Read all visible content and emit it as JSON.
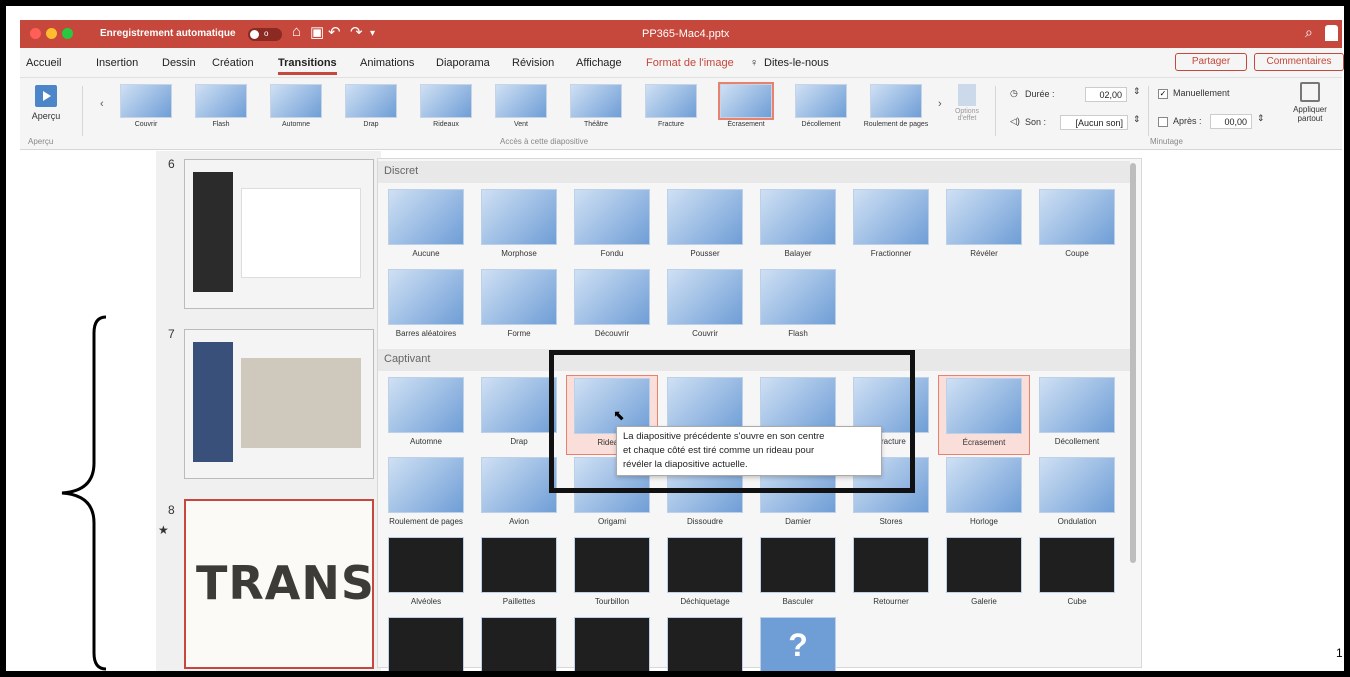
{
  "window": {
    "autosave": "Enregistrement automatique",
    "toggle_label": "o",
    "document_title": "PP365-Mac4.pptx"
  },
  "colors": {
    "accent": "#c6473b",
    "tile": "#6f9ed6",
    "tile_light": "#cfe0f4",
    "selected_tile": "#f9ded9",
    "dark_tile": "#1f1f1f"
  },
  "tabs": [
    "Accueil",
    "Insertion",
    "Dessin",
    "Création",
    "Transitions",
    "Animations",
    "Diaporama",
    "Révision",
    "Affichage",
    "Format de l'image",
    "Dites-le-nous"
  ],
  "active_tab": "Transitions",
  "share_label": "Partager",
  "comments_label": "Commentaires",
  "ribbon": {
    "preview_label": "Aperçu",
    "preview_group": "Aperçu",
    "gallery": [
      "Couvrir",
      "Flash",
      "Automne",
      "Drap",
      "Rideaux",
      "Vent",
      "Théâtre",
      "Fracture",
      "Écrasement",
      "Décollement",
      "Roulement de pages"
    ],
    "selected": "Écrasement",
    "gallery_group": "Accès à cette diapositive",
    "effect_options": "Options d'effet",
    "duration_label": "Durée :",
    "duration_value": "02,00",
    "sound_label": "Son :",
    "sound_value": "[Aucun son]",
    "manual_label": "Manuellement",
    "after_label": "Après :",
    "after_value": "00,00",
    "timing_group": "Minutage",
    "apply_all": "Appliquer partout"
  },
  "slides": [
    "6",
    "7",
    "8"
  ],
  "star": "★",
  "slide8_text": "TRANSITI",
  "sections": [
    {
      "name": "Discret",
      "items": [
        "Aucune",
        "Morphose",
        "Fondu",
        "Pousser",
        "Balayer",
        "Fractionner",
        "Révéler",
        "Coupe",
        "Barres aléatoires",
        "Forme",
        "Découvrir",
        "Couvrir",
        "Flash"
      ]
    },
    {
      "name": "Captivant",
      "items": [
        "Automne",
        "Drap",
        "Rideaux",
        "Vent",
        "Théâtre",
        "Fracture",
        "Écrasement",
        "Décollement",
        "Roulement de pages",
        "Avion",
        "Origami",
        "Dissoudre",
        "Damier",
        "Stores",
        "Horloge",
        "Ondulation",
        "Alvéoles",
        "Paillettes",
        "Tourbillon",
        "Déchiquetage",
        "Basculer",
        "Retourner",
        "Galerie",
        "Cube",
        "",
        "",
        "",
        "",
        ""
      ]
    }
  ],
  "hovered": "Rideaux",
  "selected_effect": "Écrasement",
  "tooltip": [
    "La diapositive précédente s'ouvre en son centre",
    "et chaque côté est tiré comme un rideau pour",
    "révéler la diapositive actuelle."
  ],
  "page_number": "1",
  "icons": {
    "question": "?",
    "arrow": "➜",
    "split": "⇦ ⇨"
  }
}
